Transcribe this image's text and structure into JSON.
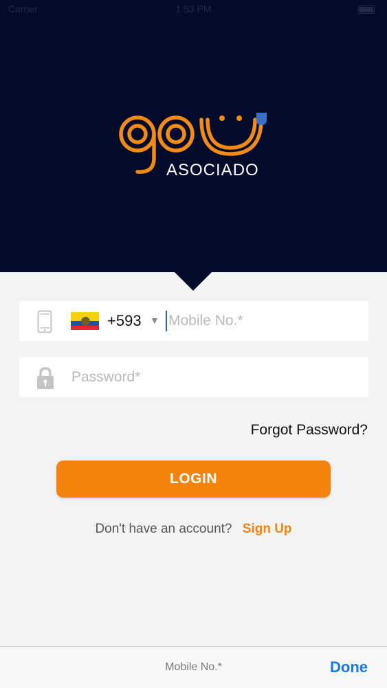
{
  "status_bar": {
    "carrier": "Carrier",
    "time": "1:53 PM"
  },
  "logo": {
    "mark": "go",
    "tagline": "ASOCIADO"
  },
  "phone_field": {
    "country_code": "+593",
    "country": "Ecuador",
    "value": "",
    "placeholder": "Mobile No.*"
  },
  "password_field": {
    "value": "",
    "placeholder": "Password*"
  },
  "forgot_password": "Forgot Password?",
  "login_button": "LOGIN",
  "signup": {
    "prompt": "Don't have an account?",
    "link": "Sign Up"
  },
  "keyboard_toolbar": {
    "field_label": "Mobile No.*",
    "done": "Done"
  },
  "colors": {
    "header_bg": "#030b2b",
    "accent": "#f5840f",
    "logo_dot": "#3a6fc9",
    "link_blue": "#1b78e0"
  },
  "icons": [
    "phone-icon",
    "lock-icon",
    "ecuador-flag-icon",
    "chevron-down-icon"
  ]
}
